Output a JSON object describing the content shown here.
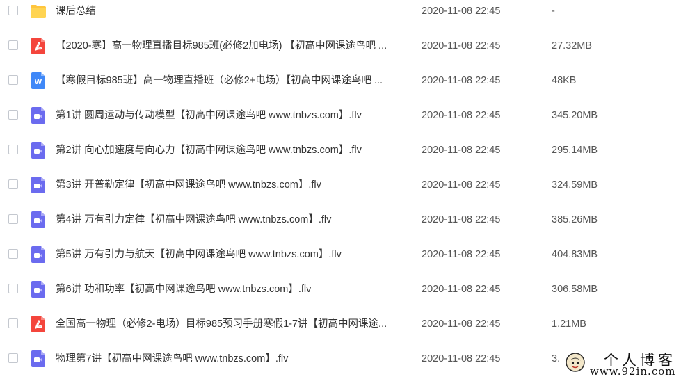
{
  "files": [
    {
      "type": "folder",
      "name": "课后总结",
      "time": "2020-11-08 22:45",
      "size": "-"
    },
    {
      "type": "pdf",
      "name": "【2020-寒】高一物理直播目标985班(必修2加电场) 【初高中网课途鸟吧 ...",
      "time": "2020-11-08 22:45",
      "size": "27.32MB"
    },
    {
      "type": "word",
      "name": "【寒假目标985班】高一物理直播班（必修2+电场）【初高中网课途鸟吧 ...",
      "time": "2020-11-08 22:45",
      "size": "48KB"
    },
    {
      "type": "video",
      "name": "第1讲 圆周运动与传动模型【初高中网课途鸟吧 www.tnbzs.com】.flv",
      "time": "2020-11-08 22:45",
      "size": "345.20MB"
    },
    {
      "type": "video",
      "name": "第2讲 向心加速度与向心力【初高中网课途鸟吧 www.tnbzs.com】.flv",
      "time": "2020-11-08 22:45",
      "size": "295.14MB"
    },
    {
      "type": "video",
      "name": "第3讲 开普勒定律【初高中网课途鸟吧 www.tnbzs.com】.flv",
      "time": "2020-11-08 22:45",
      "size": "324.59MB"
    },
    {
      "type": "video",
      "name": "第4讲 万有引力定律【初高中网课途鸟吧 www.tnbzs.com】.flv",
      "time": "2020-11-08 22:45",
      "size": "385.26MB"
    },
    {
      "type": "video",
      "name": "第5讲 万有引力与航天【初高中网课途鸟吧 www.tnbzs.com】.flv",
      "time": "2020-11-08 22:45",
      "size": "404.83MB"
    },
    {
      "type": "video",
      "name": "第6讲 功和功率【初高中网课途鸟吧 www.tnbzs.com】.flv",
      "time": "2020-11-08 22:45",
      "size": "306.58MB"
    },
    {
      "type": "pdf",
      "name": "全国高一物理（必修2-电场）目标985预习手册寒假1-7讲【初高中网课途...",
      "time": "2020-11-08 22:45",
      "size": "1.21MB"
    },
    {
      "type": "video",
      "name": "物理第7讲【初高中网课途鸟吧 www.tnbzs.com】.flv",
      "time": "2020-11-08 22:45",
      "size": "3."
    }
  ],
  "icon_names": {
    "folder": "folder-icon",
    "pdf": "pdf-file-icon",
    "word": "word-file-icon",
    "video": "video-file-icon"
  },
  "colors": {
    "folder": "#FFC53D",
    "pdf": "#F4453C",
    "word": "#3F88F8",
    "video": "#6B6BEF",
    "video_triangle": "#B7B3FA"
  },
  "watermark": {
    "title": "个人博客",
    "url": "www.92in.com"
  }
}
